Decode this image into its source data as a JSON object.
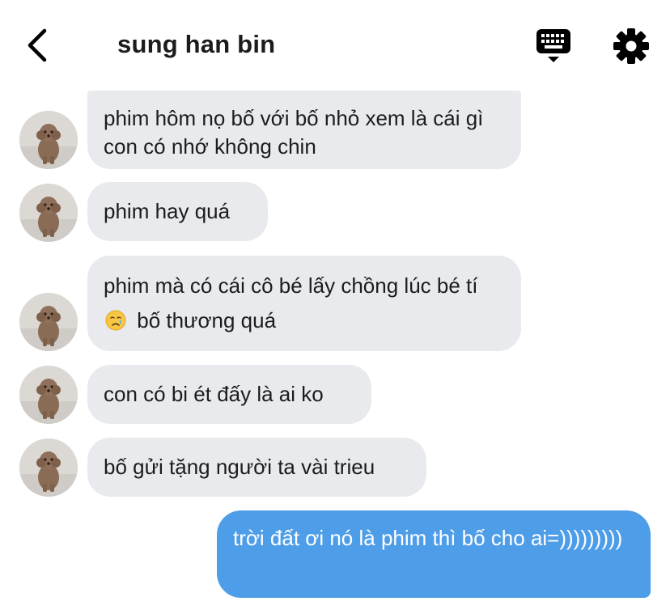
{
  "header": {
    "title": "sung han bin",
    "back_icon": "chevron-left-icon",
    "keyboard_icon": "keyboard-icon",
    "settings_icon": "gear-icon"
  },
  "messages": [
    {
      "from": "other",
      "text": "phim hôm nọ bố với bố nhỏ xem là cái gì con có nhớ không chin"
    },
    {
      "from": "other",
      "text": "phim hay quá"
    },
    {
      "from": "other",
      "text_before": "phim mà có cái cô bé lấy chồng lúc bé tí",
      "emoji": "crying-face",
      "text_after": "bố thương quá"
    },
    {
      "from": "other",
      "text": "con có bi ét đấy là ai ko"
    },
    {
      "from": "other",
      "text": "bố gửi tặng người ta vài trieu"
    },
    {
      "from": "me",
      "text": "trời đất ơi nó là phim thì bố cho ai=)))))))))"
    }
  ],
  "colors": {
    "incoming_bubble": "#e8eaee",
    "outgoing_bubble": "#4e9de8",
    "text": "#1c1c1e"
  }
}
